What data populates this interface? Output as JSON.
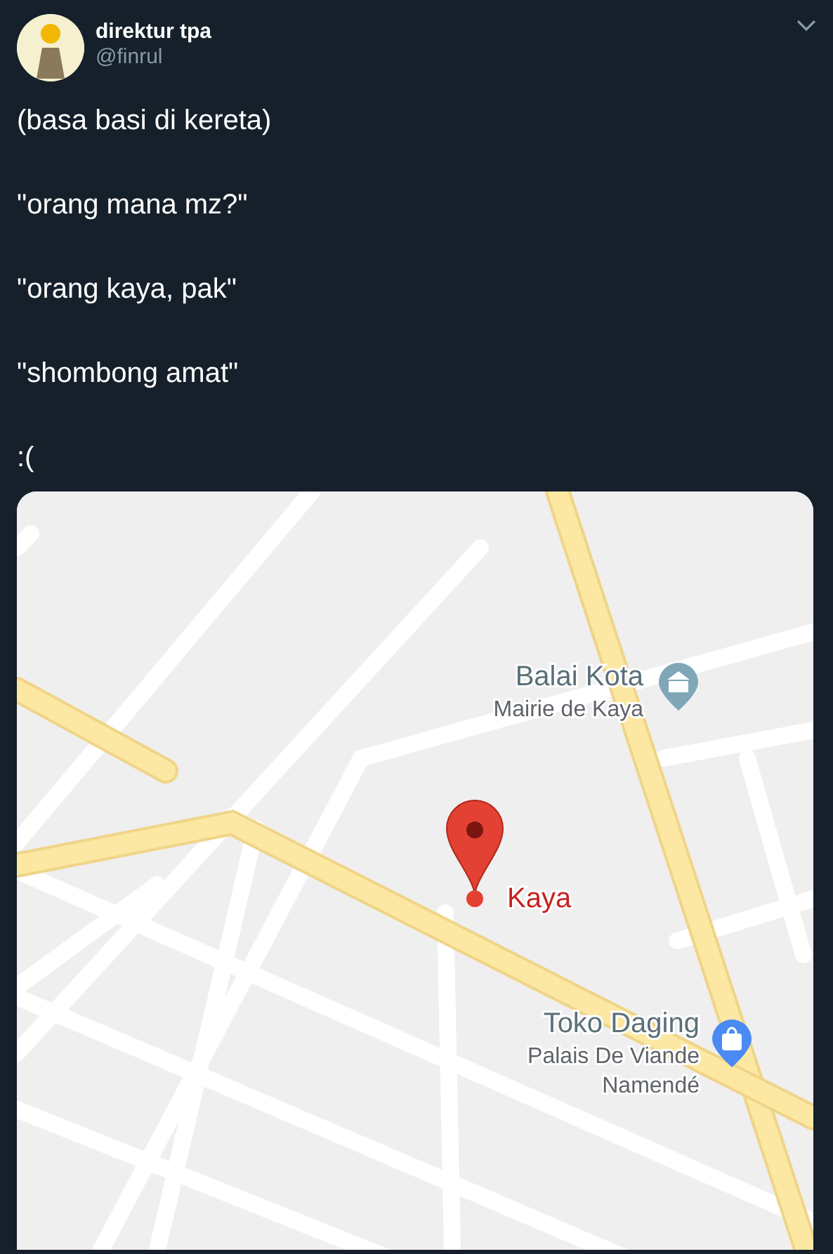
{
  "author": {
    "name": "direktur tpa",
    "handle": "@finrul"
  },
  "paragraphs": [
    "(basa basi di kereta)",
    "\"orang mana mz?\"",
    "\"orang kaya, pak\"",
    "\"shombong amat\"",
    ":("
  ],
  "map": {
    "places": [
      {
        "kind": "landmark",
        "lines": [
          "Balai Kota",
          "Mairie de Kaya"
        ]
      },
      {
        "kind": "pin",
        "lines": [
          "Kaya"
        ]
      },
      {
        "kind": "shop",
        "lines": [
          "Toko Daging",
          "Palais De Viande",
          "Namendé"
        ]
      }
    ]
  }
}
